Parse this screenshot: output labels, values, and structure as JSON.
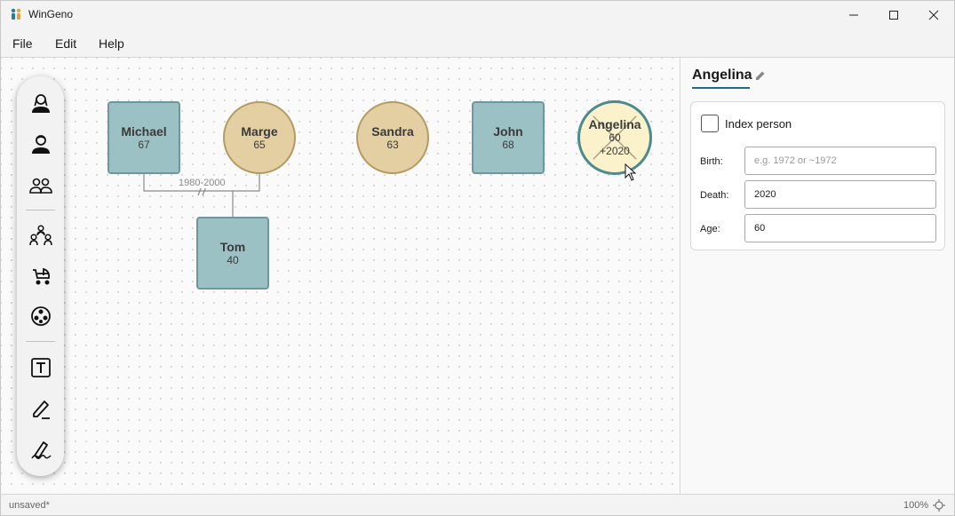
{
  "window": {
    "title": "WinGeno"
  },
  "menu": {
    "file": "File",
    "edit": "Edit",
    "help": "Help"
  },
  "toolbar": {
    "tools": [
      "add-female-icon",
      "add-male-icon",
      "add-couple-icon",
      "add-family-icon",
      "add-child-icon",
      "population-icon",
      "text-icon",
      "pen-icon",
      "signature-icon"
    ]
  },
  "pedigree": {
    "people": [
      {
        "name": "Michael",
        "age": "67",
        "sex": "male"
      },
      {
        "name": "Marge",
        "age": "65",
        "sex": "female"
      },
      {
        "name": "Sandra",
        "age": "63",
        "sex": "female"
      },
      {
        "name": "John",
        "age": "68",
        "sex": "male"
      },
      {
        "name": "Angelina",
        "age": "60",
        "death": "+2020",
        "sex": "female",
        "deceased": true
      },
      {
        "name": "Tom",
        "age": "40",
        "sex": "male"
      }
    ],
    "relationship_label": "1980-2000"
  },
  "panel": {
    "title": "Angelina",
    "index_person_label": "Index person",
    "index_person_checked": false,
    "birth_label": "Birth:",
    "birth_value": "",
    "birth_placeholder": "e.g. 1972 or ~1972",
    "death_label": "Death:",
    "death_value": "2020",
    "age_label": "Age:",
    "age_value": "60"
  },
  "status": {
    "file_state": "unsaved*",
    "zoom": "100%"
  },
  "colors": {
    "male_fill": "#9cc1c5",
    "female_fill": "#e3cfa2",
    "deceased_fill": "#fbf2cc",
    "accent": "#1c6c8c"
  }
}
